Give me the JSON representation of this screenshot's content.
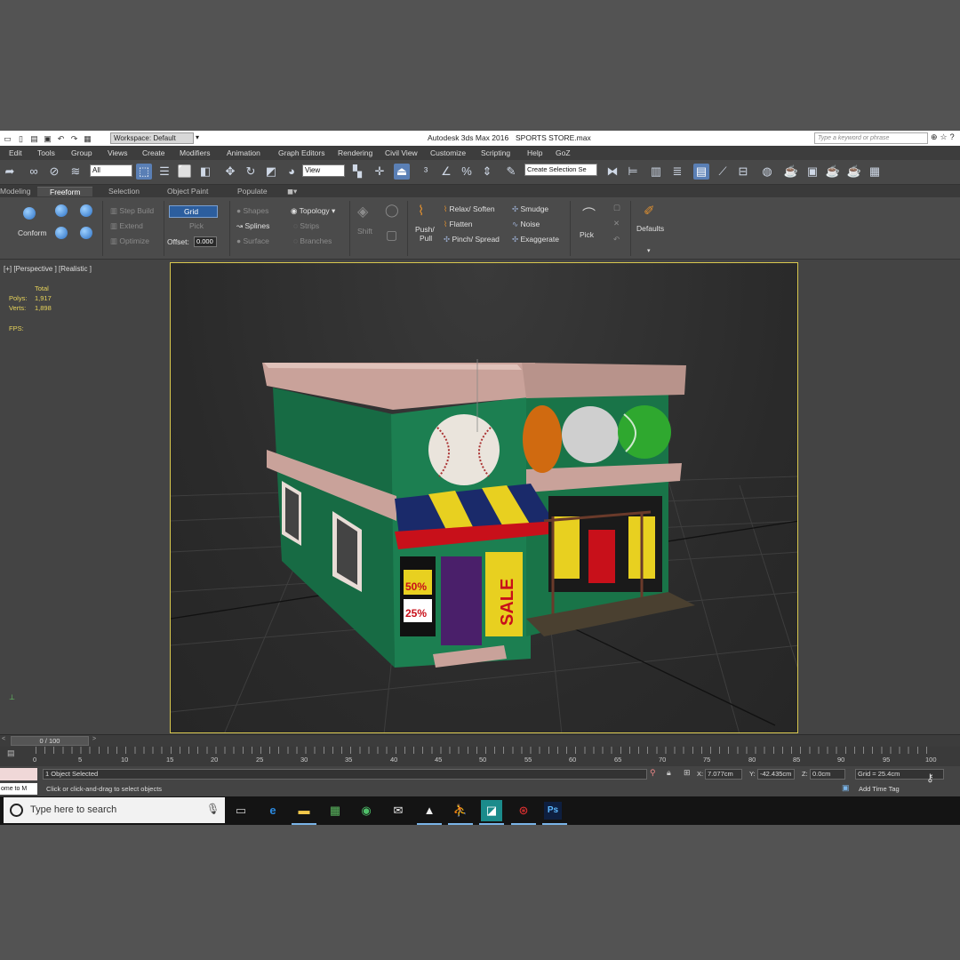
{
  "titlebar": {
    "workspace": "Workspace: Default",
    "app_name": "Autodesk 3ds Max 2016",
    "file_name": "SPORTS STORE.max",
    "search_placeholder": "Type a keyword or phrase"
  },
  "menu": [
    "Edit",
    "Tools",
    "Group",
    "Views",
    "Create",
    "Modifiers",
    "Animation",
    "Graph Editors",
    "Rendering",
    "Civil View",
    "Customize",
    "Scripting",
    "Help",
    "GoZ"
  ],
  "toolbar": {
    "selection_filter": "All",
    "ref_coord": "View",
    "named_selection": "Create Selection Se"
  },
  "ribbon_tabs": [
    "Modeling",
    "Freeform",
    "Selection",
    "Object Paint",
    "Populate"
  ],
  "ribbon": {
    "conform": "Conform",
    "step_build": "Step Build",
    "extend": "Extend",
    "optimize": "Optimize",
    "grid": "Grid",
    "pick": "Pick",
    "offset_label": "Offset:",
    "offset_value": "0.000",
    "shapes": "Shapes",
    "splines": "Splines",
    "surface": "Surface",
    "topology": "Topology",
    "strips": "Strips",
    "branches": "Branches",
    "shift": "Shift",
    "push_pull_1": "Push/",
    "push_pull_2": "Pull",
    "relax": "Relax/ Soften",
    "flatten": "Flatten",
    "pinch": "Pinch/ Spread",
    "smudge": "Smudge",
    "noise": "Noise",
    "exaggerate": "Exaggerate",
    "pick2": "Pick",
    "defaults": "Defaults"
  },
  "viewport": {
    "label": "[+] [Perspective ] [Realistic ]",
    "total": "Total",
    "polys_label": "Polys:",
    "polys": "1,917",
    "verts_label": "Verts:",
    "verts": "1,898",
    "fps_label": "FPS:",
    "sign_sale": "SALE",
    "sign_50": "50%",
    "sign_25": "25%"
  },
  "timeline": {
    "slider": "0 / 100",
    "ticks": [
      "0",
      "5",
      "10",
      "15",
      "20",
      "25",
      "30",
      "35",
      "40",
      "45",
      "50",
      "55",
      "60",
      "65",
      "70",
      "75",
      "80",
      "85",
      "90",
      "95",
      "100"
    ]
  },
  "status": {
    "selected": "1 Object Selected",
    "prompt": "Click or click-and-drag to select objects",
    "maxscript": "ome to M",
    "x_label": "X:",
    "x": "7.077cm",
    "y_label": "Y:",
    "y": "-42.435cm",
    "z_label": "Z:",
    "z": "0.0cm",
    "grid": "Grid = 25.4cm",
    "add_time_tag": "Add Time Tag"
  },
  "taskbar": {
    "search": "Type here to search"
  },
  "colors": {
    "viewport_border": "#d9c84e",
    "stat_text": "#e8d45a",
    "store_green": "#1f8a5a",
    "active_tab": "#5a7fb5"
  }
}
